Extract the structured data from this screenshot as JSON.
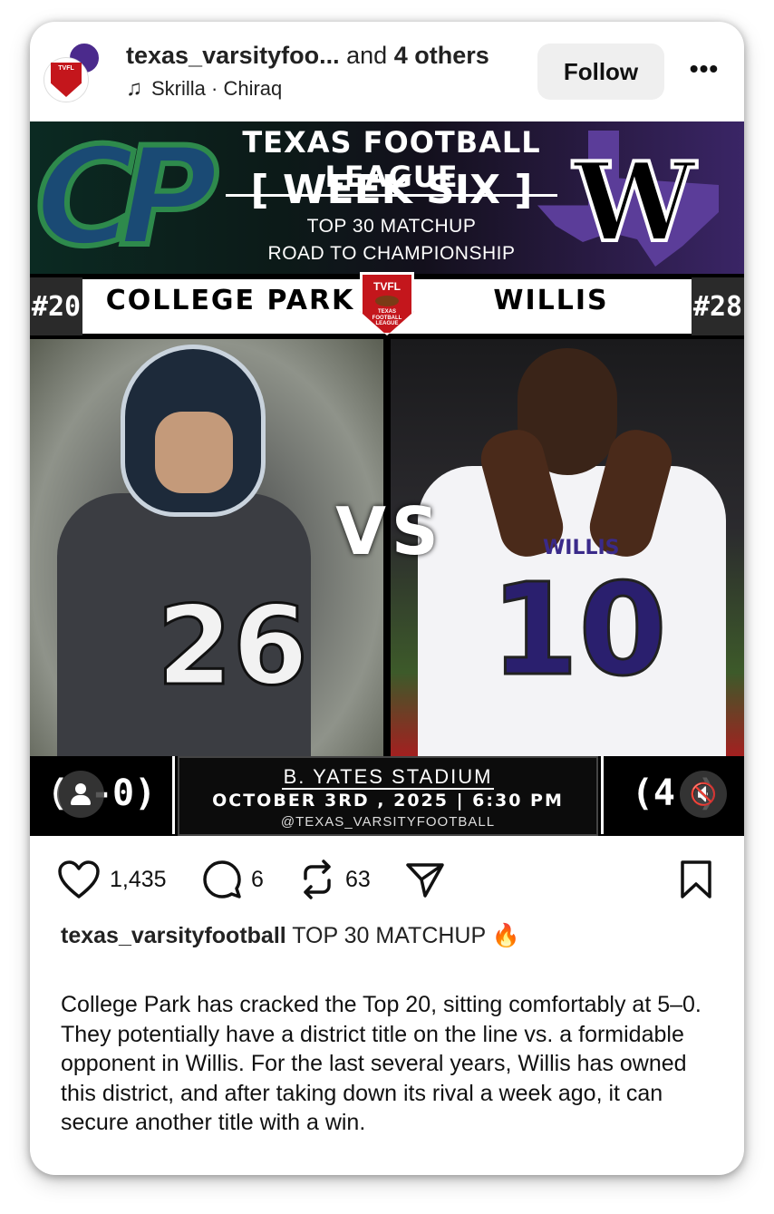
{
  "header": {
    "account_name": "texas_varsityfoo...",
    "others_prefix": "and",
    "others_count": "4 others",
    "music_icon": "music-note-icon",
    "song": "Skrilla · Chiraq",
    "follow_label": "Follow",
    "more_label": "•••",
    "avatar_text": "TVFL"
  },
  "graphic": {
    "league_title": "TEXAS FOOTBALL LEAGUE",
    "week": "[ WEEK SIX ]",
    "subtitle1": "TOP 30 MATCHUP",
    "subtitle2": "ROAD TO CHAMPIONSHIP",
    "left_logo": "CP",
    "right_logo": "W",
    "seed_left": "#20",
    "seed_right": "#28",
    "team_left": "COLLEGE PARK",
    "team_right": "WILLIS",
    "badge_top": "TVFL",
    "badge_bottom": "TEXAS FOOTBALL LEAGUE",
    "vs": "VS",
    "jersey_left": "26",
    "jersey_right": "10",
    "chest_right": "WILLIS",
    "record_left": "( -0)",
    "record_right": "(4  )",
    "stadium": "B. YATES STADIUM",
    "date_time": "OCTOBER 3RD , 2025 | 6:30 PM",
    "handle": "@TEXAS_VARSITYFOOTBALL"
  },
  "actions": {
    "like_icon": "heart-icon",
    "likes": "1,435",
    "comment_icon": "comment-bubble-icon",
    "comments": "6",
    "repost_icon": "repost-icon",
    "reposts": "63",
    "share_icon": "paper-plane-icon",
    "save_icon": "bookmark-icon"
  },
  "caption": {
    "username": "texas_varsityfootball",
    "headline": "TOP 30 MATCHUP 🔥",
    "body": "College Park has cracked the Top 20, sitting comfortably at 5–0. They potentially have a district title on the line vs. a formidable opponent in Willis. For the last several years, Willis has owned this district, and after taking down its rival a week ago, it can secure another title with a win."
  },
  "colors": {
    "follow_bg": "#efefef",
    "badge_red": "#c4161c",
    "willis_purple": "#4b2a8c",
    "cp_green": "#2e8a4c",
    "cp_navy": "#1a4a74"
  }
}
